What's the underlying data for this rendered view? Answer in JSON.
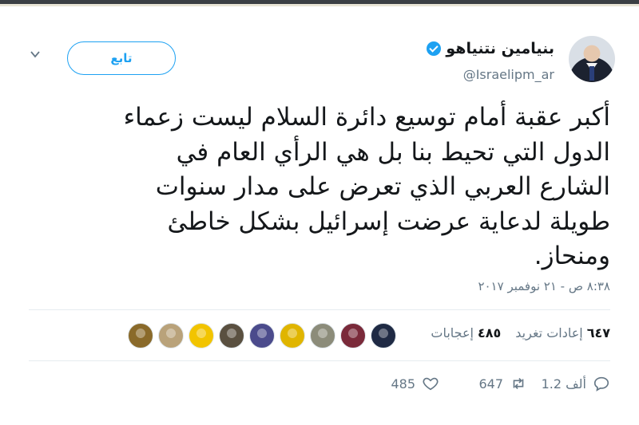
{
  "tweet": {
    "display_name": "بنيامين نتنياهو",
    "handle": "@Israelipm_ar",
    "follow_label": "تابع",
    "text": "أكبر عقبة أمام توسيع دائرة السلام ليست زعماء\nالدول التي تحيط بنا بل هي الرأي العام في\nالشارع العربي الذي تعرض على مدار سنوات\nطويلة لدعاية عرضت إسرائيل بشكل خاطئ\nومنحاز.",
    "timestamp": "٨:٣٨ ص - ٢١ نوفمبر ٢٠١٧"
  },
  "stats": {
    "retweets_count": "٦٤٧",
    "retweets_label": "إعادات تغريد",
    "likes_count": "٤٨٥",
    "likes_label": "إعجابات"
  },
  "likers": [
    {
      "icon": "user-avatar",
      "color": "#8a6a2a"
    },
    {
      "icon": "user-avatar",
      "color": "#b9a27a"
    },
    {
      "icon": "user-avatar",
      "color": "#f2c400"
    },
    {
      "icon": "user-avatar",
      "color": "#5a5040"
    },
    {
      "icon": "user-avatar",
      "color": "#4b4b8c"
    },
    {
      "icon": "user-avatar",
      "color": "#e0b500"
    },
    {
      "icon": "user-avatar",
      "color": "#8c8c7a"
    },
    {
      "icon": "user-avatar",
      "color": "#7a2a3a"
    },
    {
      "icon": "user-avatar",
      "color": "#1f2a44"
    }
  ],
  "actions": {
    "reply_count": "1.2 ألف",
    "retweet_count": "647",
    "like_count": "485"
  },
  "colors": {
    "accent": "#1da1f2",
    "muted": "#657786",
    "text": "#14171a"
  }
}
